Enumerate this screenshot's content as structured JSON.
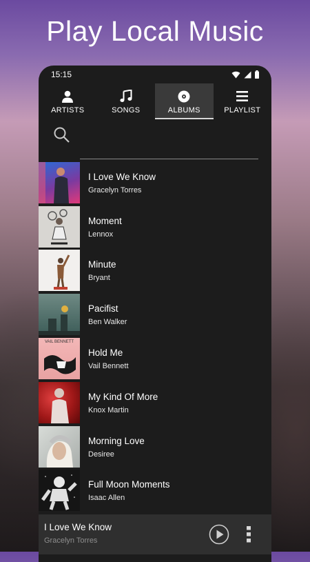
{
  "headline": "Play Local Music",
  "status": {
    "time": "15:15"
  },
  "tabs": [
    {
      "label": "ARTISTS",
      "icon": "person-icon",
      "active": false
    },
    {
      "label": "SONGS",
      "icon": "music-note-icon",
      "active": false
    },
    {
      "label": "ALBUMS",
      "icon": "album-icon",
      "active": true
    },
    {
      "label": "PLAYLIST",
      "icon": "list-icon",
      "active": false
    }
  ],
  "search": {
    "placeholder": ""
  },
  "albums": [
    {
      "title": "I Love We Know",
      "artist": "Gracelyn Torres"
    },
    {
      "title": "Moment",
      "artist": "Lennox"
    },
    {
      "title": "Minute",
      "artist": "Bryant"
    },
    {
      "title": "Pacifist",
      "artist": "Ben Walker"
    },
    {
      "title": "Hold Me",
      "artist": "Vail Bennett",
      "cover_text": "VAIL BENNETT"
    },
    {
      "title": "My Kind Of More",
      "artist": "Knox Martin"
    },
    {
      "title": "Morning Love",
      "artist": "Desiree"
    },
    {
      "title": "Full Moon Moments",
      "artist": "Isaac Allen"
    }
  ],
  "now_playing": {
    "title": "I Love We Know",
    "artist": "Gracelyn Torres"
  },
  "colors": {
    "panel": "#1c1c1c",
    "active_tab": "#3a3a3a",
    "player": "#2f2f2f"
  }
}
